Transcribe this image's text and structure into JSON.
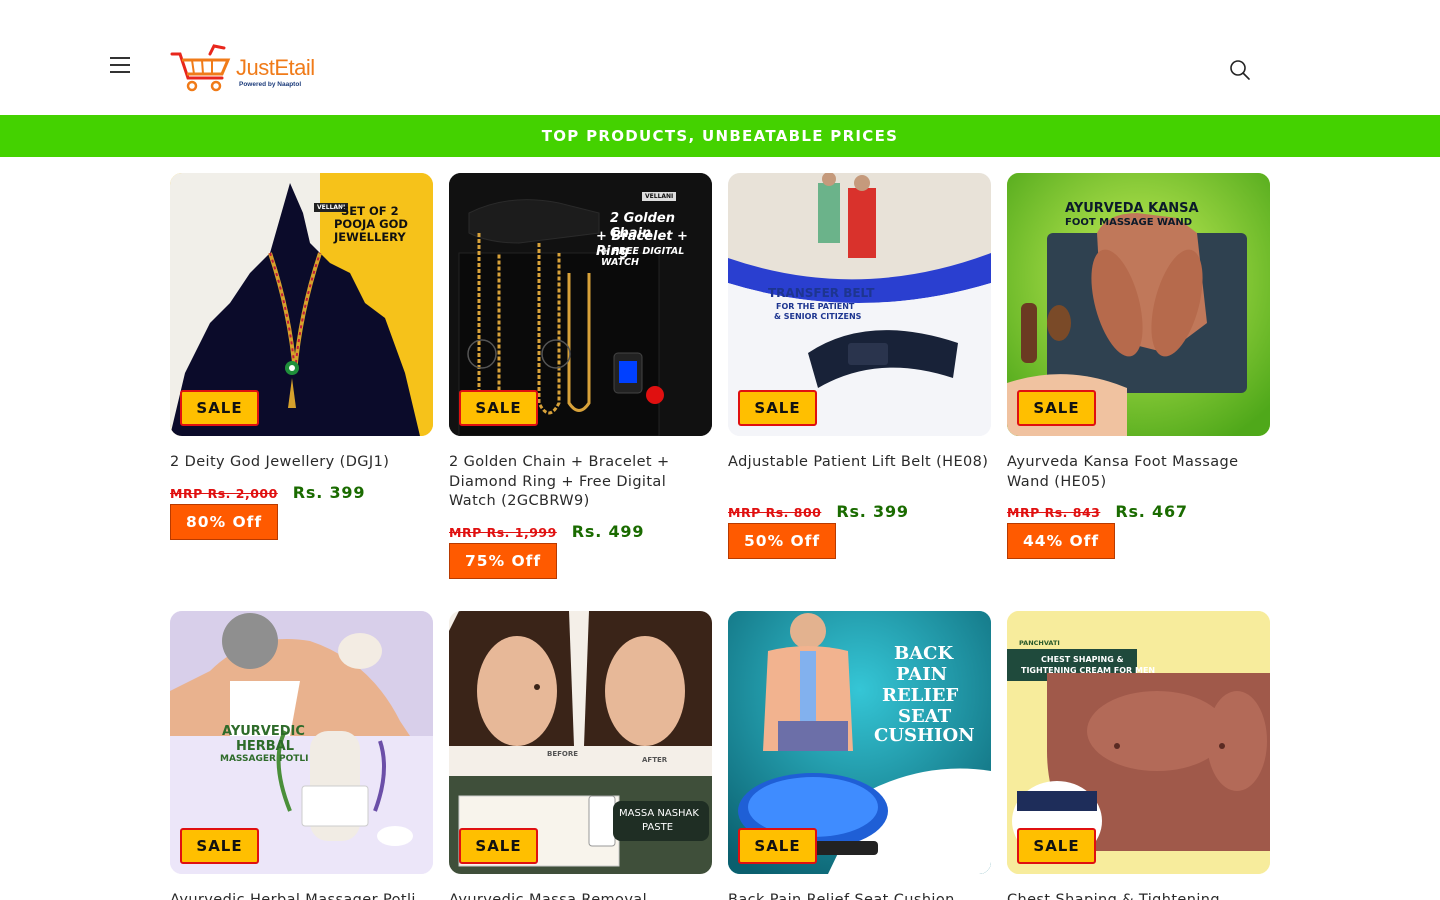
{
  "header": {
    "logo_text": "JustEtail",
    "logo_sub": "Powered by Naaptol"
  },
  "announcement": "TOP PRODUCTS, UNBEATABLE PRICES",
  "sale_label": "SALE",
  "products": [
    {
      "title": "2 Deity God Jewellery (DGJ1)",
      "mrp": "MRP Rs. 2,000",
      "price": "Rs. 399",
      "discount": "80% Off",
      "image_text": [
        "SET OF 2",
        "POOJA GOD",
        "JEWELLERY"
      ],
      "brand": "VELLANI"
    },
    {
      "title": "2 Golden Chain + Bracelet + Diamond Ring + Free Digital Watch (2GCBRW9)",
      "mrp": "MRP Rs. 1,999",
      "price": "Rs. 499",
      "discount": "75% Off",
      "image_text": [
        "2 Golden Chain",
        "+ Bracelet + Ring",
        "+ FREE DIGITAL WATCH"
      ],
      "brand": "VELLANI"
    },
    {
      "title": "Adjustable Patient Lift Belt (HE08)",
      "mrp": "MRP Rs. 800",
      "price": "Rs. 399",
      "discount": "50% Off",
      "image_text": [
        "TRANSFER BELT",
        "FOR THE PATIENT",
        "& SENIOR CITIZENS"
      ]
    },
    {
      "title": "Ayurveda Kansa Foot Massage Wand (HE05)",
      "mrp": "MRP Rs. 843",
      "price": "Rs. 467",
      "discount": "44% Off",
      "image_text": [
        "AYURVEDA KANSA",
        "FOOT MASSAGE WAND"
      ]
    },
    {
      "title": "Ayurvedic Herbal Massager Potli",
      "image_text": [
        "AYURVEDIC",
        "HERBAL",
        "MASSAGER POTLI"
      ]
    },
    {
      "title": "Ayurvedic Massa Removal",
      "image_text": [
        "MASSA NASHAK",
        "PASTE",
        "BEFORE",
        "AFTER"
      ]
    },
    {
      "title": "Back Pain Relief Seat Cushion",
      "image_text": [
        "BACK",
        "PAIN",
        "RELIEF",
        "SEAT",
        "CUSHION"
      ]
    },
    {
      "title": "Chest Shaping & Tightening",
      "image_text": [
        "CHEST SHAPING &",
        "TIGHTENING CREAM FOR MEN"
      ],
      "brand": "PANCHVATI"
    }
  ],
  "colors": {
    "announce_bg": "#44d200",
    "sale_bg": "#ffbf00",
    "sale_border": "#e01010",
    "off_bg": "#ff5a00",
    "price": "#1a6b00",
    "mrp": "#e01010",
    "logo": "#f07b19"
  },
  "icons": [
    "menu-icon",
    "search-icon",
    "cart-icon"
  ]
}
